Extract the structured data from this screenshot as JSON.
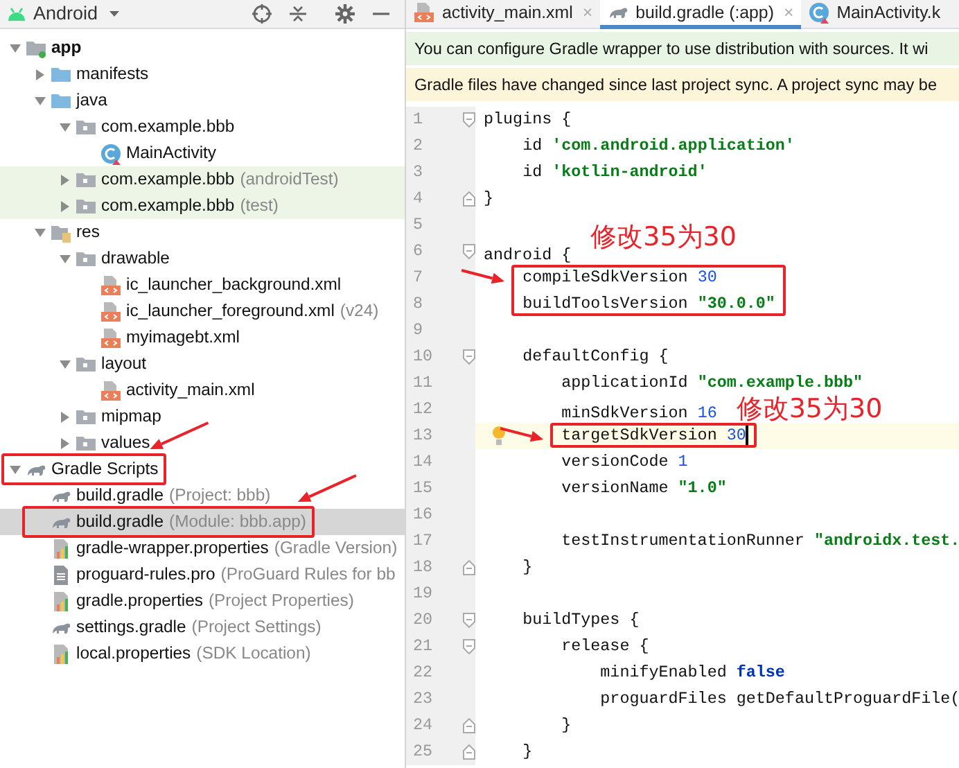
{
  "sidebar": {
    "view": "Android",
    "tree": [
      {
        "label": "app",
        "kind": "module",
        "expanded": true,
        "children": [
          {
            "label": "manifests",
            "kind": "folder",
            "expanded": false
          },
          {
            "label": "java",
            "kind": "folder",
            "expanded": true,
            "children": [
              {
                "label": "com.example.bbb",
                "kind": "package",
                "expanded": true,
                "children": [
                  {
                    "label": "MainActivity",
                    "kind": "kotlin"
                  }
                ]
              },
              {
                "label": "com.example.bbb",
                "hint": "(androidTest)",
                "kind": "package",
                "expanded": false,
                "test": true
              },
              {
                "label": "com.example.bbb",
                "hint": "(test)",
                "kind": "package",
                "expanded": false,
                "test": true
              }
            ]
          },
          {
            "label": "res",
            "kind": "res",
            "expanded": true,
            "children": [
              {
                "label": "drawable",
                "kind": "package",
                "expanded": true,
                "children": [
                  {
                    "label": "ic_launcher_background.xml",
                    "kind": "xml"
                  },
                  {
                    "label": "ic_launcher_foreground.xml",
                    "hint": "(v24)",
                    "kind": "xml"
                  },
                  {
                    "label": "myimagebt.xml",
                    "kind": "xml"
                  }
                ]
              },
              {
                "label": "layout",
                "kind": "package",
                "expanded": true,
                "children": [
                  {
                    "label": "activity_main.xml",
                    "kind": "xml"
                  }
                ]
              },
              {
                "label": "mipmap",
                "kind": "package",
                "expanded": false
              },
              {
                "label": "values",
                "kind": "package",
                "expanded": false
              }
            ]
          }
        ]
      },
      {
        "label": "Gradle Scripts",
        "kind": "gradle",
        "expanded": true,
        "highlighted": true,
        "children": [
          {
            "label": "build.gradle",
            "hint": "(Project: bbb)",
            "kind": "gradle",
            "selected": false,
            "highlighted": false
          },
          {
            "label": "build.gradle",
            "hint": "(Module: bbb.app)",
            "kind": "gradle",
            "selected": true,
            "highlighted": true
          },
          {
            "label": "gradle-wrapper.properties",
            "hint": "(Gradle Version)",
            "kind": "properties",
            "selected": false,
            "highlighted": false
          },
          {
            "label": "proguard-rules.pro",
            "hint": "(ProGuard Rules for bb",
            "kind": "text",
            "selected": false,
            "highlighted": false
          },
          {
            "label": "gradle.properties",
            "hint": "(Project Properties)",
            "kind": "properties",
            "selected": false,
            "highlighted": false
          },
          {
            "label": "settings.gradle",
            "hint": "(Project Settings)",
            "kind": "gradle",
            "selected": false,
            "highlighted": false
          },
          {
            "label": "local.properties",
            "hint": "(SDK Location)",
            "kind": "properties",
            "selected": false,
            "highlighted": false
          }
        ]
      }
    ]
  },
  "editor": {
    "tabs": [
      {
        "label": "activity_main.xml",
        "kind": "xml",
        "selected": false,
        "close": "×"
      },
      {
        "label": "build.gradle (:app)",
        "kind": "gradle",
        "selected": true,
        "close": "×"
      },
      {
        "label": "MainActivity.k",
        "kind": "kotlin",
        "selected": false
      }
    ],
    "banners": [
      {
        "kind": "info",
        "text": "You can configure Gradle wrapper to use distribution with sources. It wi"
      },
      {
        "kind": "warning",
        "text": "Gradle files have changed since last project sync. A project sync may be"
      }
    ],
    "lines": [
      {
        "number": "1",
        "fold_open": true,
        "tokens": [
          {
            "kind": "plain",
            "text": "plugins {"
          }
        ]
      },
      {
        "number": "2",
        "tokens": [
          {
            "kind": "plain",
            "text": "    id "
          },
          {
            "kind": "string",
            "text": "'com.android.application'"
          }
        ]
      },
      {
        "number": "3",
        "tokens": [
          {
            "kind": "plain",
            "text": "    id "
          },
          {
            "kind": "string",
            "text": "'kotlin-android'"
          }
        ]
      },
      {
        "number": "4",
        "fold_close": true,
        "tokens": [
          {
            "kind": "plain",
            "text": "}"
          }
        ]
      },
      {
        "number": "5"
      },
      {
        "number": "6",
        "fold_open": true,
        "tokens": [
          {
            "kind": "plain",
            "text": "android {"
          }
        ],
        "note": "修改35为30"
      },
      {
        "number": "7",
        "highlighted": true,
        "tokens": [
          {
            "kind": "plain",
            "text": "    compileSdkVersion "
          },
          {
            "kind": "number",
            "text": "30"
          }
        ]
      },
      {
        "number": "8",
        "highlighted": true,
        "tokens": [
          {
            "kind": "plain",
            "text": "    buildToolsVersion "
          },
          {
            "kind": "string",
            "text": "\"30.0.0\""
          }
        ]
      },
      {
        "number": "9"
      },
      {
        "number": "10",
        "fold_open": true,
        "tokens": [
          {
            "kind": "plain",
            "text": "    defaultConfig {"
          }
        ]
      },
      {
        "number": "11",
        "tokens": [
          {
            "kind": "plain",
            "text": "        applicationId "
          },
          {
            "kind": "string",
            "text": "\"com.example.bbb\""
          }
        ]
      },
      {
        "number": "12",
        "tokens": [
          {
            "kind": "plain",
            "text": "        minSdkVersion "
          },
          {
            "kind": "number",
            "text": "16"
          }
        ],
        "note": "修改35为30"
      },
      {
        "number": "13",
        "current": true,
        "bulb": true,
        "highlighted": true,
        "tokens": [
          {
            "kind": "plain",
            "text": "        targetSdkVersion "
          },
          {
            "kind": "number",
            "text": "30"
          }
        ]
      },
      {
        "number": "14",
        "tokens": [
          {
            "kind": "plain",
            "text": "        versionCode "
          },
          {
            "kind": "number",
            "text": "1"
          }
        ]
      },
      {
        "number": "15",
        "tokens": [
          {
            "kind": "plain",
            "text": "        versionName "
          },
          {
            "kind": "string",
            "text": "\"1.0\""
          }
        ]
      },
      {
        "number": "16"
      },
      {
        "number": "17",
        "tokens": [
          {
            "kind": "plain",
            "text": "        testInstrumentationRunner "
          },
          {
            "kind": "string",
            "text": "\"androidx.test."
          }
        ]
      },
      {
        "number": "18",
        "fold_close": true,
        "tokens": [
          {
            "kind": "plain",
            "text": "    }"
          }
        ]
      },
      {
        "number": "19"
      },
      {
        "number": "20",
        "fold_open": true,
        "tokens": [
          {
            "kind": "plain",
            "text": "    buildTypes {"
          }
        ]
      },
      {
        "number": "21",
        "fold_open": true,
        "tokens": [
          {
            "kind": "plain",
            "text": "        release {"
          }
        ]
      },
      {
        "number": "22",
        "tokens": [
          {
            "kind": "plain",
            "text": "            minifyEnabled "
          },
          {
            "kind": "keyword",
            "text": "false"
          }
        ]
      },
      {
        "number": "23",
        "tokens": [
          {
            "kind": "plain",
            "text": "            proguardFiles getDefaultProguardFile("
          }
        ]
      },
      {
        "number": "24",
        "fold_close": true,
        "tokens": [
          {
            "kind": "plain",
            "text": "        }"
          }
        ]
      },
      {
        "number": "25",
        "fold_close": true,
        "tokens": [
          {
            "kind": "plain",
            "text": "    }"
          }
        ]
      }
    ]
  }
}
